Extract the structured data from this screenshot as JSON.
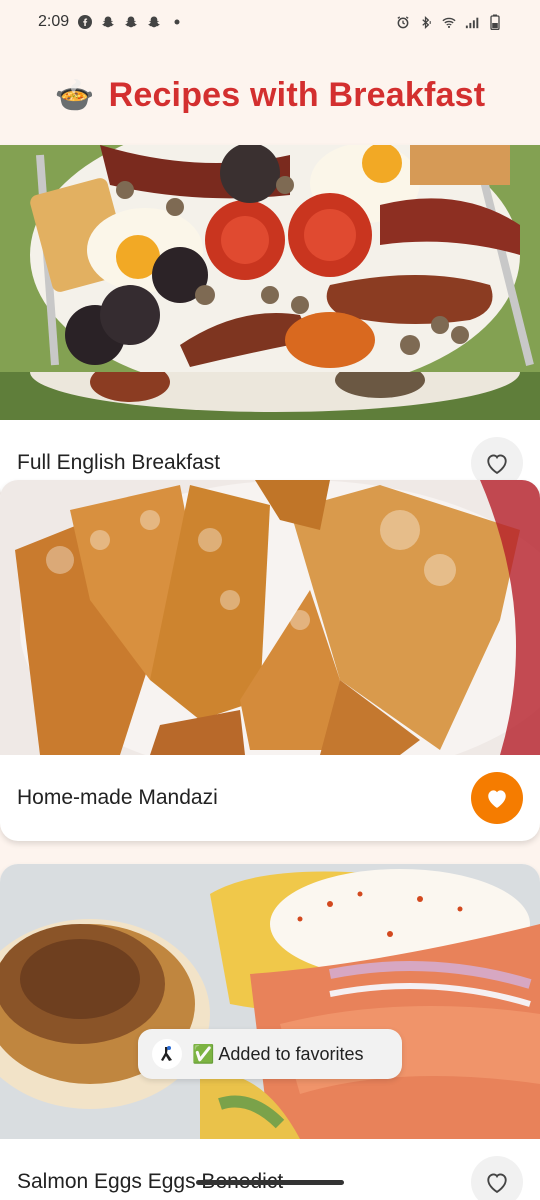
{
  "status_bar": {
    "time": "2:09",
    "left_icons": [
      "facebook-icon",
      "snapchat-icon",
      "snapchat-icon",
      "snapchat-icon",
      "dot-icon"
    ],
    "right_icons": [
      "alarm-icon",
      "bluetooth-icon",
      "wifi-icon",
      "signal-icon",
      "battery-icon"
    ]
  },
  "header": {
    "emoji": "🍲",
    "title": "Recipes with Breakfast",
    "title_color": "#d32f2f"
  },
  "recipes": [
    {
      "title": "Full English Breakfast",
      "favorite": false,
      "image": "full-english-breakfast-photo"
    },
    {
      "title": "Home-made Mandazi",
      "favorite": true,
      "image": "mandazi-photo"
    },
    {
      "title": "Salmon Eggs Eggs Benedict",
      "favorite": false,
      "image": "salmon-eggs-benedict-photo"
    }
  ],
  "toast": {
    "text": "✅ Added to favorites"
  },
  "colors": {
    "background": "#fdf4ee",
    "favorite_active": "#f57c00",
    "favorite_inactive": "#f1f1f1"
  }
}
